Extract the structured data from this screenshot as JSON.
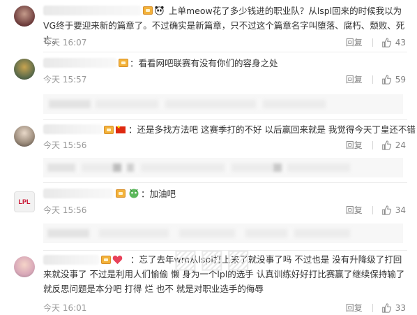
{
  "comments": [
    {
      "text": "上单meow花了多少钱进的职业队？从lspl回来的时候我以为VG终于要迎来新的篇章了。不过确实是新篇章，只不过这个篇章名字叫堕落、腐朽、颓败、死亡。",
      "time": "今天 16:07",
      "reply": "回复",
      "likes": "43"
    },
    {
      "text": "：看看网吧联赛有没有你们的容身之处",
      "time": "今天 15:57",
      "reply": "回复",
      "likes": "59"
    },
    {
      "text": "：还是多找方法吧 这赛季打的不好 以后赢回来就是 我觉得今天丁皇还不错",
      "time": "今天 15:56",
      "reply": "回复",
      "likes": "24"
    },
    {
      "text": "：加油吧",
      "time": "今天 15:56",
      "reply": "回复",
      "likes": "34",
      "avatar_text": "LPL"
    },
    {
      "text": "：忘了去年wm从lspl打上来了就没事了吗 不过也是 没有升降级了打回来就没事了 不过是利用人们愉偷 懒 身为一个lpl的选手 认真训练好好打比赛赢了继续保持输了就反思问题是本分吧 打得 烂 也不 就是对职业选手的侮辱",
      "time": "今天 16:01",
      "reply": "回复",
      "likes": "33"
    }
  ],
  "colors": {
    "meta": "#999999",
    "text": "#333333",
    "flag": "#de2910",
    "heart": "#e8425a"
  },
  "icons": [
    "thumb-up-icon",
    "panda-emoji-icon",
    "dragon-emoji-icon",
    "heart-emoji-icon",
    "china-flag-icon",
    "vip-badge-icon"
  ]
}
